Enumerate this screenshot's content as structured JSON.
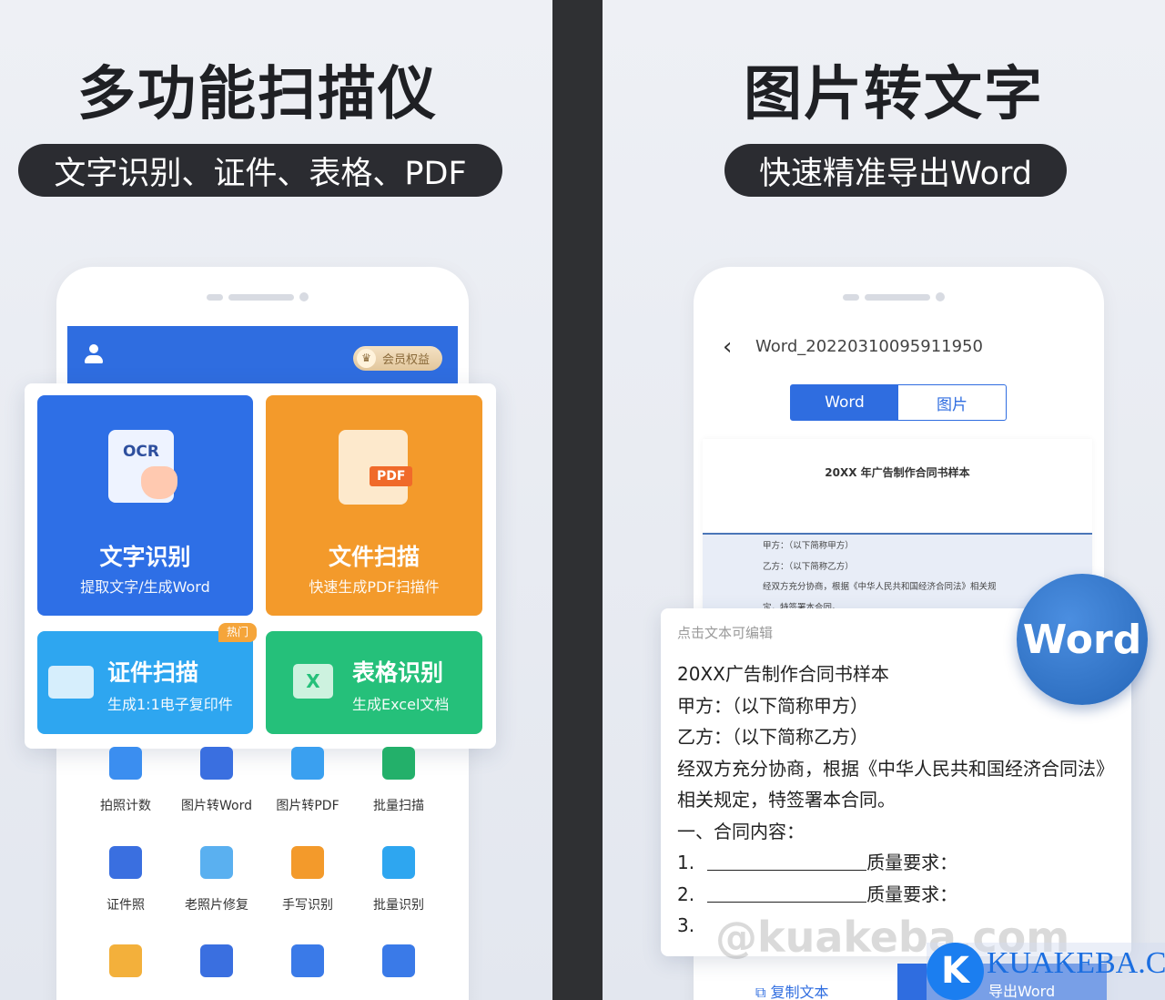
{
  "left": {
    "title": "多功能扫描仪",
    "subtitle": "文字识别、证件、表格、PDF",
    "header": {
      "member_badge": "会员权益"
    },
    "tiles": [
      {
        "title": "文字识别",
        "desc": "提取文字/生成Word",
        "icon_text": "OCR",
        "color": "#2e6fe6"
      },
      {
        "title": "文件扫描",
        "desc": "快速生成PDF扫描件",
        "icon_text": "PDF",
        "color": "#f39a2b"
      },
      {
        "title": "证件扫描",
        "desc": "生成1:1电子复印件",
        "tag": "热门",
        "color": "#2ea6f0"
      },
      {
        "title": "表格识别",
        "desc": "生成Excel文档",
        "color": "#25c07a"
      }
    ],
    "grid": [
      {
        "label": "拍照计数",
        "icon": "camera-count-icon",
        "color": "#3b8ef0"
      },
      {
        "label": "图片转Word",
        "icon": "word-icon",
        "color": "#3a6fe0"
      },
      {
        "label": "图片转PDF",
        "icon": "image-pdf-icon",
        "color": "#3aa0f0"
      },
      {
        "label": "批量扫描",
        "icon": "batch-scan-icon",
        "color": "#23b06a"
      },
      {
        "label": "证件照",
        "icon": "id-photo-icon",
        "color": "#3a6fe0"
      },
      {
        "label": "老照片修复",
        "icon": "photo-repair-icon",
        "color": "#5ab0f0"
      },
      {
        "label": "手写识别",
        "icon": "handwriting-icon",
        "color": "#f39a2b"
      },
      {
        "label": "批量识别",
        "icon": "batch-recognize-icon",
        "color": "#2ea6f0"
      },
      {
        "label": "",
        "icon": "translate-icon",
        "color": "#f3b03b"
      },
      {
        "label": "",
        "icon": "number-doc-icon",
        "color": "#3a6fe0"
      },
      {
        "label": "",
        "icon": "toolbox-icon",
        "color": "#3a7ae8"
      },
      {
        "label": "",
        "icon": "more-grid-icon",
        "color": "#3a7ae8"
      }
    ]
  },
  "right": {
    "title": "图片转文字",
    "subtitle": "快速精准导出Word",
    "filename": "Word_20220310095911950",
    "tabs": [
      "Word",
      "图片"
    ],
    "doc_title": "20XX 年广告制作合同书样本",
    "doc_lines": [
      "甲方：（以下简称甲方）",
      "乙方：（以下简称乙方）",
      "经双方充分协商，根据《中华人民共和国经济合同法》相关规",
      "定，特签署本合同。"
    ],
    "edit_hint": "点击文本可编辑",
    "text": {
      "l1": "20XX广告制作合同书样本",
      "l2": "甲方：（以下简称甲方）",
      "l3": "乙方：（以下简称乙方）",
      "l4": "经双方充分协商，根据《中华人民共和国经济合同法》",
      "l5": "相关规定，特签署本合同。",
      "l6": "一、合同内容：",
      "n1": "1.",
      "n2": "2.",
      "n3": "3.",
      "q": "质量要求："
    },
    "word_badge": "Word",
    "copy_button": "复制文本",
    "export_button": "导出Word"
  },
  "watermark": {
    "text": "@kuakeba.com",
    "logo": "KUAKEBA.CN",
    "logo_letter": "K"
  }
}
